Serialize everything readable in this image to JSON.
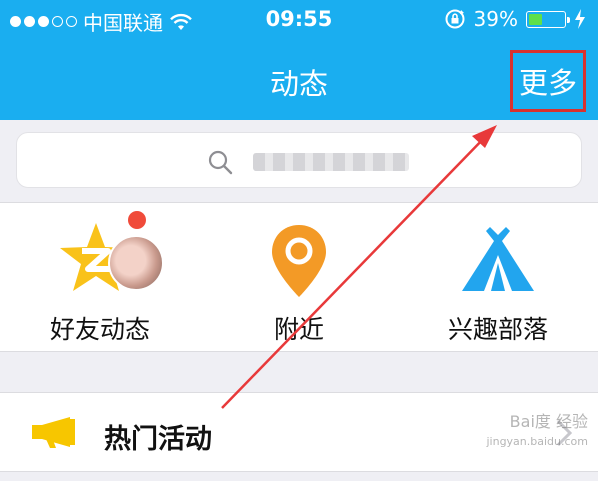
{
  "status_bar": {
    "carrier": "中国联通",
    "time": "09:55",
    "battery_percent": "39%",
    "battery_level": 0.39,
    "signal_bars_filled": 3,
    "signal_bars_total": 5,
    "icons": [
      "signal-dots-icon",
      "wifi-icon",
      "orientation-lock-icon",
      "battery-icon",
      "charging-bolt-icon"
    ]
  },
  "nav": {
    "title": "动态",
    "more_label": "更多"
  },
  "search": {
    "icon": "search-icon"
  },
  "shortcuts": [
    {
      "label": "好友动态",
      "icon": "qzone-star-icon",
      "badge": true
    },
    {
      "label": "附近",
      "icon": "location-pin-icon"
    },
    {
      "label": "兴趣部落",
      "icon": "tent-icon"
    }
  ],
  "list": {
    "hot_activity_label": "热门活动",
    "hot_icon": "megaphone-icon"
  },
  "watermark": {
    "line1": "Bai度 经验",
    "line2": "jingyan.baidu.com"
  },
  "colors": {
    "primary_blue": "#1aaef0",
    "highlight_red": "#d9312f",
    "badge_red": "#f04b3a",
    "star_yellow": "#f9c21a",
    "pin_orange": "#f39a26",
    "tent_blue": "#22a5ee",
    "megaphone_yellow": "#f7c600"
  }
}
